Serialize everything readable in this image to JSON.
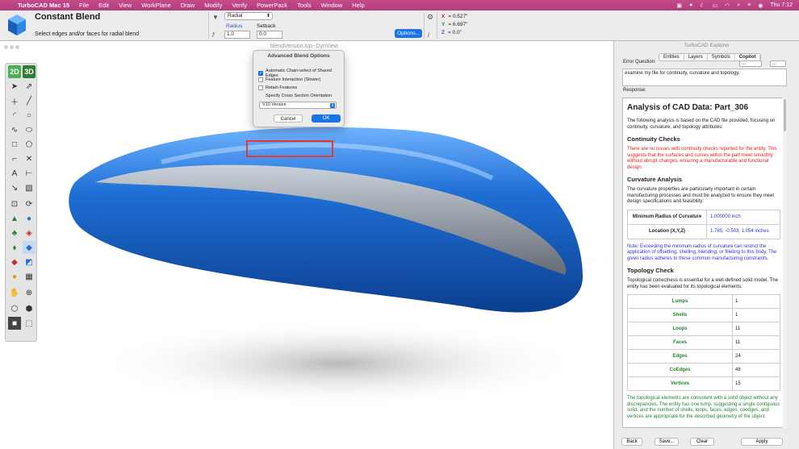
{
  "menubar": {
    "app": "TurboCAD Mac 15",
    "items": [
      "File",
      "Edit",
      "View",
      "WorkPlane",
      "Draw",
      "Modify",
      "Verify",
      "PowerPack",
      "Tools",
      "Window",
      "Help"
    ],
    "time": "Thu 7:12"
  },
  "toolbar": {
    "title": "Constant Blend",
    "hint": "Select edges and/or faces for radial blend",
    "mode": "Radial",
    "radius_label": "Radius",
    "radius_value": "1.0",
    "setback_label": "Setback",
    "setback_value": "0.0",
    "options_label": "Options...",
    "x_label": "X",
    "x_value": "= 0.527\"",
    "y_label": "Y",
    "y_value": "= 6.697\"",
    "z_label": "Z",
    "z_value": "= 0.0\""
  },
  "canvas": {
    "window_title": "blendVersion.tcp--DynView",
    "body_color": "#1e6fd0",
    "band_color": "#9a9a9a"
  },
  "dialog": {
    "title": "Advanced Blend Options",
    "options": [
      {
        "label": "Automatic Chain-select of Shared Edges",
        "checked": true
      },
      {
        "label": "Feature Interaction (Slower)",
        "checked": false
      },
      {
        "label": "Retain Features",
        "checked": false
      },
      {
        "label": "Specify Cross Section Orientation",
        "checked": false
      }
    ],
    "version": "V10 Version",
    "cancel": "Cancel",
    "ok": "OK"
  },
  "explorer": {
    "title": "TurboCAD Explorer",
    "tabs": [
      "Entities",
      "Layers",
      "Symbols",
      "Copilot"
    ],
    "active_tab": "Copilot",
    "error_question_label": "Error Question:",
    "question": "examine my file for  continuity, curvature and topology.",
    "response_label": "Response:",
    "report": {
      "title": "Analysis of CAD Data: Part_306",
      "intro": "The following analysis is based on the CAD file provided, focusing on continuity, curvature, and topology attributes:",
      "continuity_heading": "Continuity Checks",
      "continuity_text": "There are no issues with continuity checks reported for the entity. This suggests that the surfaces and curves within the part meet smoothly without abrupt changes, ensuring a manufacturable and functional design.",
      "curvature_heading": "Curvature Analysis",
      "curvature_text": "The curvature properties are particularly important in certain manufacturing processes and must be analyzed to ensure they meet design specifications and feasibility:",
      "curvature_rows": [
        {
          "k": "Minimum Radius of Curvature",
          "v": "1.000000 inch"
        },
        {
          "k": "Location (X,Y,Z)",
          "v": "1.785, -0.503, 1.054 inches"
        }
      ],
      "curvature_note": "Note: Exceeding the minimum radius of curvature can restrict the application of offsetting, shelling, blending, or filleting to this body. The given radius adheres to these common manufacturing constraints.",
      "topology_heading": "Topology Check",
      "topology_text": "Topological correctness is essential for a well-defined solid model. The entity has been evaluated for its topological elements:",
      "topology_rows": [
        {
          "k": "Lumps",
          "v": "1"
        },
        {
          "k": "Shells",
          "v": "1"
        },
        {
          "k": "Loops",
          "v": "11"
        },
        {
          "k": "Faces",
          "v": "11"
        },
        {
          "k": "Edges",
          "v": "24"
        },
        {
          "k": "CoEdges",
          "v": "48"
        },
        {
          "k": "Vertices",
          "v": "15"
        }
      ],
      "topology_conclusion": "The topological elements are consistent with a solid object without any discrepancies. The entity has one lump, suggesting a single contiguous solid, and the number of shells, loops, faces, edges, coedges, and vertices are appropriate for the described geometry of the object."
    },
    "buttons": {
      "back": "Back",
      "save": "Save...",
      "clear": "Clear",
      "apply": "Apply"
    }
  }
}
